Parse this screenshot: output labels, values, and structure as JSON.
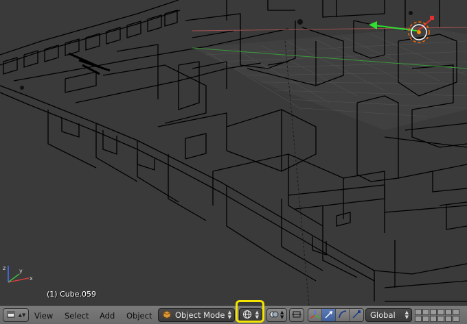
{
  "viewport": {
    "active_object_label": "(1) Cube.059"
  },
  "header": {
    "editor_type_icon": "3d-view-cube-icon",
    "menus": [
      "View",
      "Select",
      "Add",
      "Object"
    ],
    "mode_select": {
      "value": "Object Mode",
      "icon": "object-mode-cube-icon"
    },
    "viewport_shading_icon": "wireframe-sphere-icon",
    "pivot_icon": "pivot-point-icon",
    "transform_orientation": {
      "value": "Global"
    },
    "highlight_color": "#f5e400"
  },
  "colors": {
    "viewport_bg": "#3a3a3a",
    "header_bg": "#727272",
    "wire": "#000000",
    "x_axis": "#d04040",
    "y_axis": "#40d040",
    "z_axis": "#4a6fff",
    "selected_origin": "#ff8c00"
  }
}
